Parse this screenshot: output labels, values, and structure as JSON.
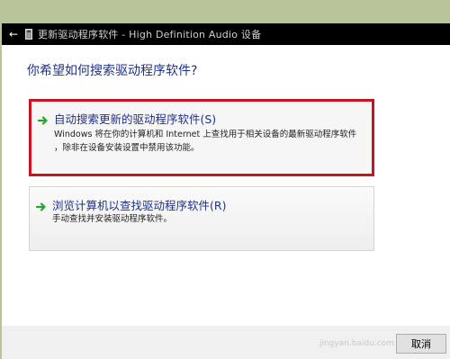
{
  "titlebar": {
    "title": "更新驱动程序软件 - High Definition Audio 设备",
    "back_icon": "back-arrow-icon",
    "device_icon": "device-icon"
  },
  "question": "你希望如何搜索驱动程序软件?",
  "options": [
    {
      "title": "自动搜索更新的驱动程序软件(S)",
      "desc_line1": "Windows 将在你的计算机和 Internet 上查找用于相关设备的最新驱动程序软件",
      "desc_line2": "，除非在设备安装设置中禁用该功能。",
      "icon": "green-arrow-icon"
    },
    {
      "title": "浏览计算机以查找驱动程序软件(R)",
      "desc_line1": "手动查找并安装驱动程序软件。",
      "icon": "green-arrow-icon"
    }
  ],
  "footer": {
    "cancel_label": "取消",
    "watermark": "jingyan.baidu.com"
  },
  "colors": {
    "accent_text": "#1e3287",
    "highlight_border": "#c8141e",
    "arrow_green": "#2aa52a"
  }
}
